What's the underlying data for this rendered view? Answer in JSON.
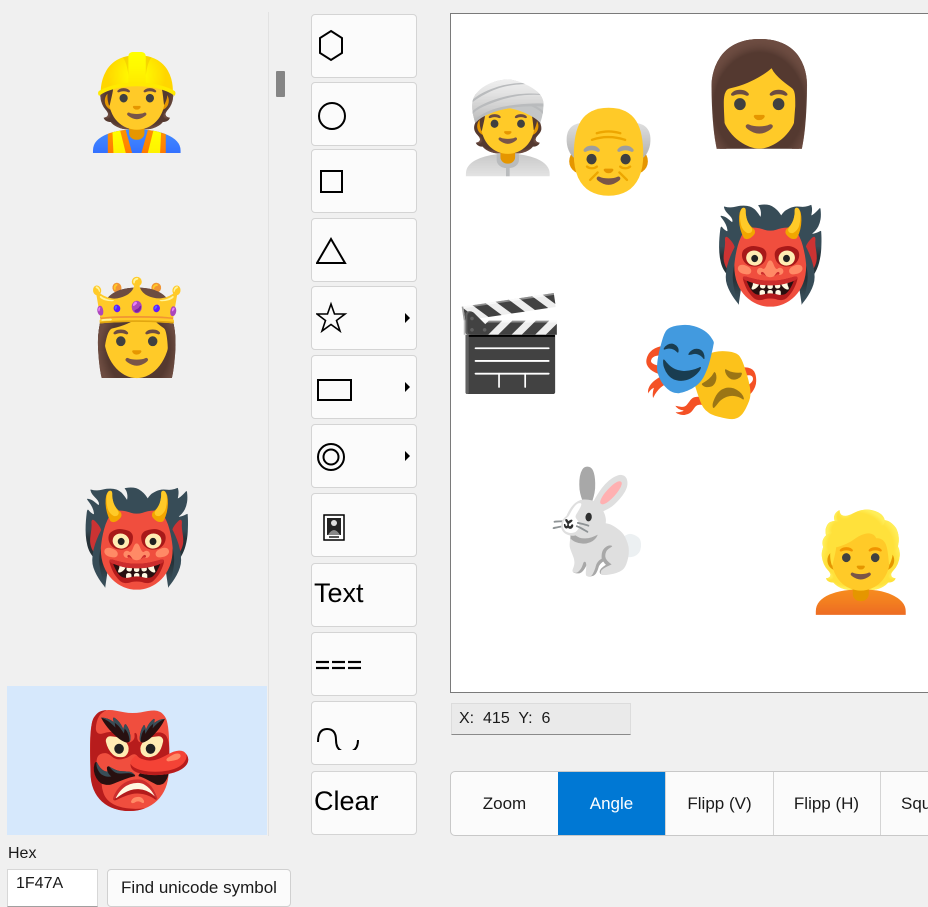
{
  "emoji_list": {
    "items": [
      {
        "glyph": "👷",
        "name": "construction-worker"
      },
      {
        "glyph": "👸",
        "name": "princess"
      },
      {
        "glyph": "👹",
        "name": "ogre"
      },
      {
        "glyph": "👺",
        "name": "goblin"
      }
    ],
    "selected_index": 3
  },
  "hex": {
    "label": "Hex",
    "value": "1F47A"
  },
  "find_button": "Find unicode symbol",
  "tools": {
    "hexagon": "hexagon",
    "circle": "circle",
    "square": "square",
    "triangle": "triangle",
    "star": "star",
    "rectangle": "rectangle",
    "ring": "ring",
    "image": "image",
    "text": "Text",
    "dashed_line": "dashed-line",
    "curve": "curve",
    "clear": "Clear"
  },
  "canvas": {
    "stamps": [
      {
        "glyph": "👳",
        "name": "person-turban"
      },
      {
        "glyph": "👴",
        "name": "old-man"
      },
      {
        "glyph": "👩",
        "name": "woman"
      },
      {
        "glyph": "👹",
        "name": "ogre"
      },
      {
        "glyph": "🎬",
        "name": "clapper-board"
      },
      {
        "glyph": "🎭",
        "name": "performing-arts"
      },
      {
        "glyph": "🐇",
        "name": "rabbit"
      },
      {
        "glyph": "👱",
        "name": "blond-person"
      }
    ]
  },
  "coords": {
    "x_label": "X:",
    "x_value": "415",
    "y_label": "Y:",
    "y_value": "6"
  },
  "modes": {
    "items": [
      "Zoom",
      "Angle",
      "Flipp (V)",
      "Flipp (H)",
      "Squ"
    ],
    "active": "Angle"
  },
  "colors": {
    "accent": "#0078d4",
    "selected_bg": "#d6e8fc"
  }
}
